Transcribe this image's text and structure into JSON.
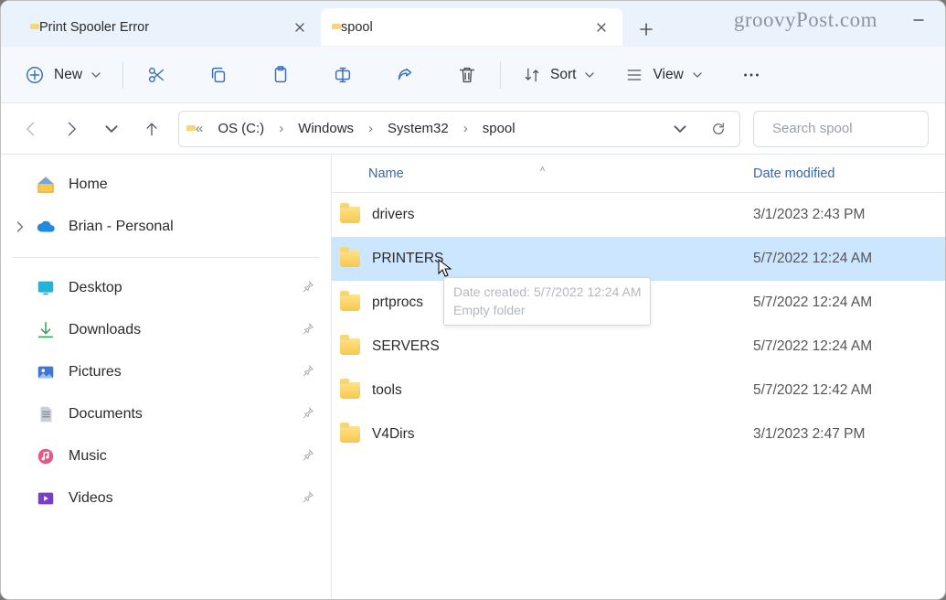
{
  "tabs": [
    {
      "label": "Print Spooler Error",
      "active": false
    },
    {
      "label": "spool",
      "active": true
    }
  ],
  "watermark": "groovyPost.com",
  "toolbar": {
    "new_label": "New",
    "sort_label": "Sort",
    "view_label": "View"
  },
  "breadcrumb": {
    "root_hint": "«",
    "segments": [
      "OS (C:)",
      "Windows",
      "System32",
      "spool"
    ]
  },
  "search": {
    "placeholder": "Search spool"
  },
  "sidebar": {
    "top": [
      {
        "name": "home",
        "label": "Home",
        "expander": false
      },
      {
        "name": "onedrive",
        "label": "Brian - Personal",
        "expander": true
      }
    ],
    "pinned": [
      {
        "name": "desktop",
        "label": "Desktop"
      },
      {
        "name": "downloads",
        "label": "Downloads"
      },
      {
        "name": "pictures",
        "label": "Pictures"
      },
      {
        "name": "documents",
        "label": "Documents"
      },
      {
        "name": "music",
        "label": "Music"
      },
      {
        "name": "videos",
        "label": "Videos"
      }
    ]
  },
  "columns": {
    "name": "Name",
    "date": "Date modified"
  },
  "rows": [
    {
      "name": "drivers",
      "date": "3/1/2023 2:43 PM",
      "selected": false
    },
    {
      "name": "PRINTERS",
      "date": "5/7/2022 12:24 AM",
      "selected": true
    },
    {
      "name": "prtprocs",
      "date": "5/7/2022 12:24 AM",
      "selected": false
    },
    {
      "name": "SERVERS",
      "date": "5/7/2022 12:24 AM",
      "selected": false
    },
    {
      "name": "tools",
      "date": "5/7/2022 12:42 AM",
      "selected": false
    },
    {
      "name": "V4Dirs",
      "date": "3/1/2023 2:47 PM",
      "selected": false
    }
  ],
  "tooltip": {
    "line1": "Date created: 5/7/2022 12:24 AM",
    "line2": "Empty folder"
  }
}
